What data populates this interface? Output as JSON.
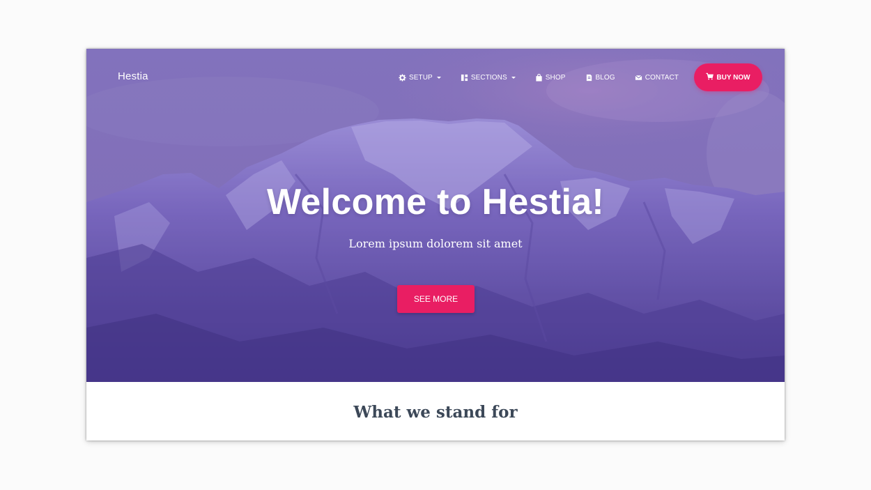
{
  "brand": {
    "name": "Hestia"
  },
  "nav": {
    "items": [
      {
        "label": "SETUP",
        "icon": "gear-icon",
        "has_dropdown": true
      },
      {
        "label": "SECTIONS",
        "icon": "sections-icon",
        "has_dropdown": true
      },
      {
        "label": "SHOP",
        "icon": "shopping-bag-icon",
        "has_dropdown": false
      },
      {
        "label": "BLOG",
        "icon": "blog-icon",
        "has_dropdown": false
      },
      {
        "label": "CONTACT",
        "icon": "envelope-icon",
        "has_dropdown": false
      }
    ],
    "cta": {
      "label": "BUY NOW",
      "icon": "cart-icon"
    }
  },
  "hero": {
    "title": "Welcome to Hestia!",
    "subtitle": "Lorem ipsum dolorem sit amet",
    "button_label": "SEE MORE"
  },
  "section": {
    "title": "What we stand for"
  },
  "colors": {
    "accent": "#e91e63",
    "hero_overlay": "#6a58b0",
    "heading_text": "#3c4858"
  }
}
